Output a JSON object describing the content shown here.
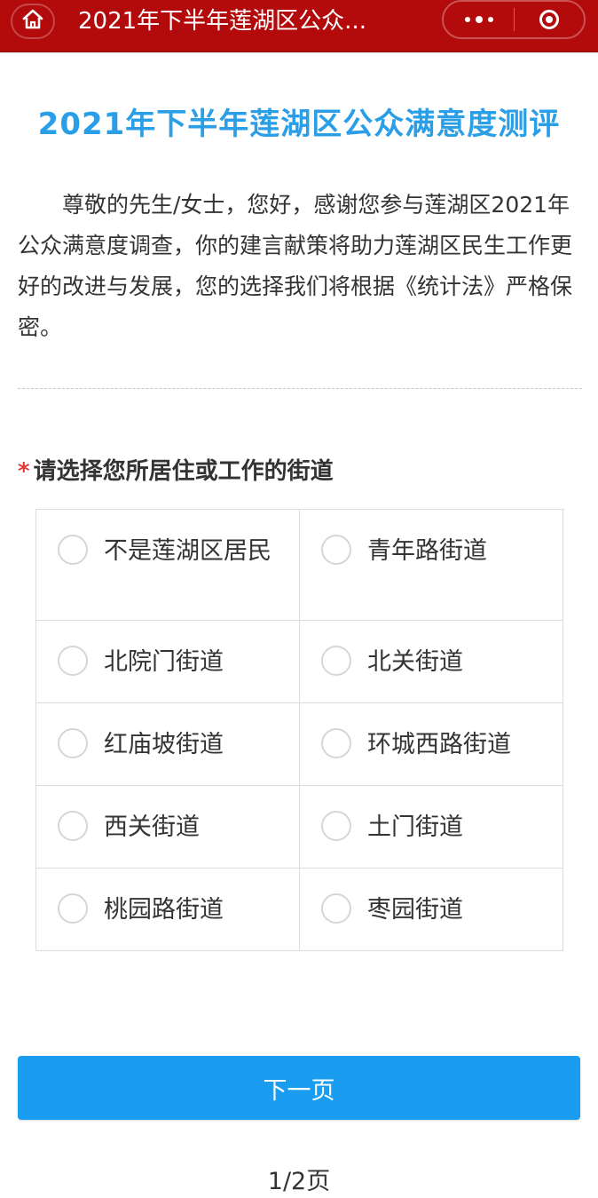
{
  "app_bar": {
    "title": "2021年下半年莲湖区公众...",
    "home_icon": "home-icon",
    "more_icon": "more-dots-icon",
    "close_icon": "target-close-icon",
    "background": "#b30b0b"
  },
  "survey": {
    "title": "2021年下半年莲湖区公众满意度测评",
    "intro": "尊敬的先生/女士，您好，感谢您参与莲湖区2021年公众满意度调查，你的建言献策将助力莲湖区民生工作更好的改进与发展，您的选择我们将根据《统计法》严格保密。",
    "accent_color": "#2a9ee6"
  },
  "question": {
    "required_mark": "*",
    "label": "请选择您所居住或工作的街道",
    "options": [
      {
        "label": "不是莲湖区居民",
        "selected": false
      },
      {
        "label": "青年路街道",
        "selected": false
      },
      {
        "label": "北院门街道",
        "selected": false
      },
      {
        "label": "北关街道",
        "selected": false
      },
      {
        "label": "红庙坡街道",
        "selected": false
      },
      {
        "label": "环城西路街道",
        "selected": false
      },
      {
        "label": "西关街道",
        "selected": false
      },
      {
        "label": "土门街道",
        "selected": false
      },
      {
        "label": "桃园路街道",
        "selected": false
      },
      {
        "label": "枣园街道",
        "selected": false
      }
    ]
  },
  "footer": {
    "next_label": "下一页",
    "page_indicator": "1/2页",
    "button_color": "#1a9cf0"
  }
}
